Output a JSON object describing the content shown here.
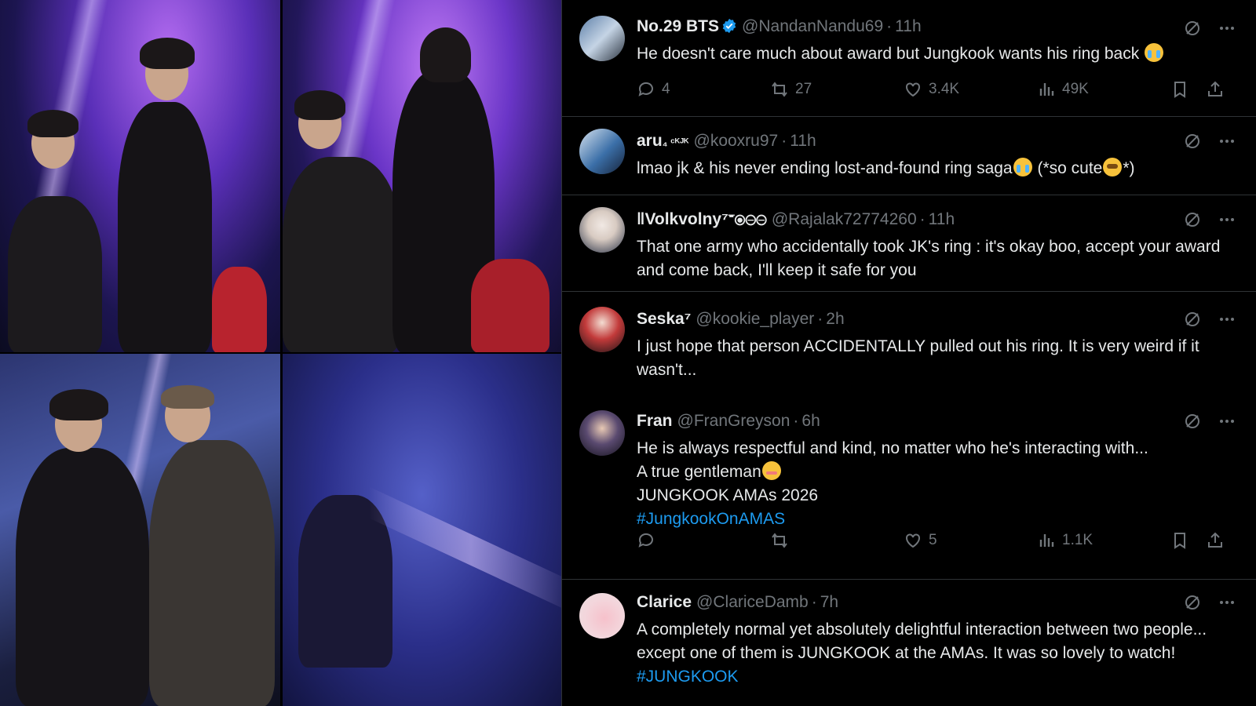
{
  "tweets": [
    {
      "name": "No.29 BTS",
      "verified": true,
      "handle": "@NandanNandu69",
      "time": "11h",
      "text_before": "He doesn't care much about award but Jungkook wants his ring back ",
      "emoji": "loudly-crying-face",
      "replies": "4",
      "retweets": "27",
      "likes": "3.4K",
      "views": "49K"
    },
    {
      "name": "aru",
      "name_suffix": "₄ ᶜᴷᴶᴷ",
      "handle": "@kooxru97",
      "time": "11h",
      "text_before": "lmao jk & his never ending lost-and-found ring saga",
      "text_middle": " (*so cute",
      "text_after": "*)",
      "emoji": "loudly-crying-face",
      "emoji2": "pleading-face"
    },
    {
      "name": "‖Volkvolny⁷𝄻⦿⊝⊝",
      "handle": "@Rajalak72774260",
      "time": "11h",
      "text": "That one army who accidentally took JK's ring : it's okay boo, accept your award and come back, I'll keep it safe for you"
    },
    {
      "name": "Seska⁷",
      "handle": "@kookie_player",
      "time": "2h",
      "text": "I just hope that person ACCIDENTALLY pulled out his ring. It is very weird if it wasn't..."
    },
    {
      "name": "Fran",
      "handle": "@FranGreyson",
      "time": "6h",
      "line1": "He is always respectful and kind, no matter who he's interacting with...",
      "line2": "A true gentleman",
      "emoji": "smiling-face",
      "line3": "JUNGKOOK AMAs 2026",
      "hashtag": "#JungkookOnAMAS",
      "likes": "5",
      "views": "1.1K"
    },
    {
      "name": "Clarice",
      "handle": "@ClariceDamb",
      "time": "7h",
      "text": "A completely normal yet absolutely delightful interaction between two people... except one of them is JUNGKOOK at the AMAs. It was so lovely to watch! ",
      "hashtag": "#JUNGKOOK"
    }
  ],
  "colors": {
    "background": "#000000",
    "text": "#e7e9ea",
    "muted": "#71767b",
    "link": "#1d9bf0",
    "divider": "#2f3336",
    "verified": "#1d9bf0"
  },
  "icons": [
    "grok-icon",
    "more-icon",
    "reply-icon",
    "retweet-icon",
    "like-icon",
    "views-icon",
    "bookmark-icon",
    "share-icon"
  ]
}
